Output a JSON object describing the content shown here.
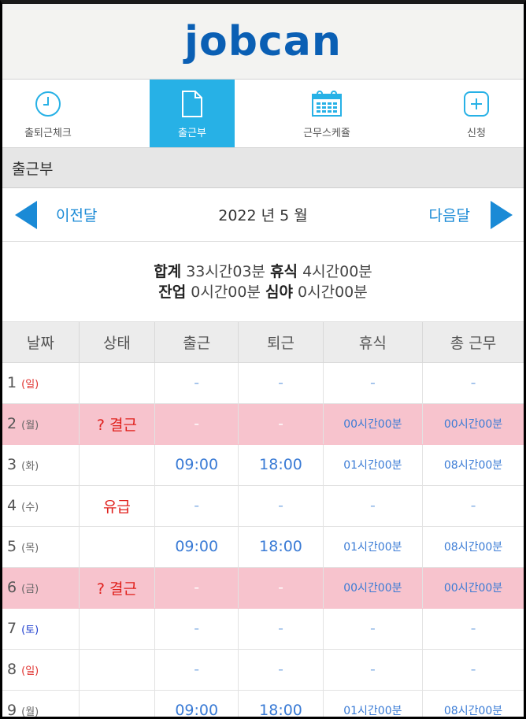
{
  "brand": {
    "logo_text": "jobcan",
    "color": "#0a5fb4"
  },
  "nav": {
    "items": [
      {
        "label": "출퇴근체크",
        "icon": "clock-icon"
      },
      {
        "label": "출근부",
        "icon": "document-icon",
        "active": true
      },
      {
        "label": "근무스케쥴",
        "icon": "calendar-icon"
      },
      {
        "label": "신청",
        "icon": "plus-icon"
      }
    ],
    "active_color": "#27b1e6"
  },
  "section": {
    "title": "출근부"
  },
  "month_nav": {
    "prev_label": "이전달",
    "current": "2022 년 5 월",
    "next_label": "다음달"
  },
  "summary": {
    "total_label": "합계",
    "total_value": "33시간03분",
    "break_label": "휴식",
    "break_value": "4시간00분",
    "overtime_label": "잔업",
    "overtime_value": "0시간00분",
    "night_label": "심야",
    "night_value": "0시간00분"
  },
  "table": {
    "headers": [
      "날짜",
      "상태",
      "출근",
      "퇴근",
      "휴식",
      "총 근무"
    ],
    "rows": [
      {
        "day": "1",
        "weekday": "(일)",
        "status": "",
        "in": "-",
        "out": "-",
        "break": "-",
        "total": "-"
      },
      {
        "day": "2",
        "weekday": "(월)",
        "status": "? 결근",
        "in": "-",
        "out": "-",
        "break": "00시간00분",
        "total": "00시간00분"
      },
      {
        "day": "3",
        "weekday": "(화)",
        "status": "",
        "in": "09:00",
        "out": "18:00",
        "break": "01시간00분",
        "total": "08시간00분"
      },
      {
        "day": "4",
        "weekday": "(수)",
        "status": "유급",
        "in": "-",
        "out": "-",
        "break": "-",
        "total": "-"
      },
      {
        "day": "5",
        "weekday": "(목)",
        "status": "",
        "in": "09:00",
        "out": "18:00",
        "break": "01시간00분",
        "total": "08시간00분"
      },
      {
        "day": "6",
        "weekday": "(금)",
        "status": "? 결근",
        "in": "-",
        "out": "-",
        "break": "00시간00분",
        "total": "00시간00분"
      },
      {
        "day": "7",
        "weekday": "(토)",
        "status": "",
        "in": "-",
        "out": "-",
        "break": "-",
        "total": "-"
      },
      {
        "day": "8",
        "weekday": "(일)",
        "status": "",
        "in": "-",
        "out": "-",
        "break": "-",
        "total": "-"
      },
      {
        "day": "9",
        "weekday": "(월)",
        "status": "",
        "in": "09:00",
        "out": "18:00",
        "break": "01시간00분",
        "total": "08시간00분"
      }
    ]
  },
  "colors": {
    "absent_row": "#f7c3cd",
    "time_blue": "#3a7bd5",
    "status_red": "#e0201c",
    "link_blue": "#1a8ad6"
  }
}
